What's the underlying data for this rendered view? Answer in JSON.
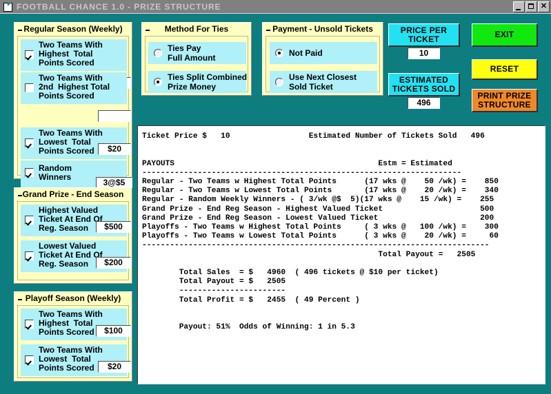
{
  "window": {
    "title": "FOOTBALL CHANCE  1.0 - PRIZE STRUCTURE",
    "minimize_label": "_",
    "maximize_label": "□",
    "close_label": "×",
    "colors": {
      "desktop": "#0d7d80",
      "titlebar": "#808080",
      "panel": "#ffffc0",
      "row": "#b0f0f8",
      "cyan_button": "#22e2f2",
      "green_button": "#10e810",
      "yellow_button": "#ffff10",
      "orange_button": "#f08828"
    }
  },
  "regular_season": {
    "title": "Regular Season (Weekly)",
    "rows": [
      {
        "label": "Two Teams With\nHighest  Total\nPoints Scored",
        "checked": true,
        "value": "$50"
      },
      {
        "label": "Two Teams With\n2nd  Highest Total\nPoints Scored",
        "checked": false,
        "value": ""
      },
      {
        "label": "Two Teams With\nLowest  Total\nPoints Scored",
        "checked": true,
        "value": "$20"
      },
      {
        "label": "Random\nWinners",
        "checked": true,
        "value": "3@$5"
      }
    ]
  },
  "grand_prize": {
    "title": "Grand Prize - End Season",
    "rows": [
      {
        "label": "Highest Valued\nTicket At End Of\nReg. Season",
        "checked": true,
        "value": "$500"
      },
      {
        "label": "Lowest Valued\nTicket At End Of\nReg. Season",
        "checked": true,
        "value": "$200"
      }
    ]
  },
  "playoff_season": {
    "title": "Playoff Season  (Weekly)",
    "rows": [
      {
        "label": "Two Teams With\nHighest  Total\nPoints Scored",
        "checked": true,
        "value": "$100"
      },
      {
        "label": "Two Teams With\nLowest  Total\nPoints Scored",
        "checked": true,
        "value": "$20"
      }
    ]
  },
  "method_for_ties": {
    "title": "Method For Ties",
    "options": [
      {
        "label": "Ties Pay\nFull Amount",
        "selected": false
      },
      {
        "label": "Ties Split Combined\nPrize Money",
        "selected": true
      }
    ]
  },
  "payment_unsold": {
    "title": "Payment - Unsold Tickets",
    "options": [
      {
        "label": "Not Paid",
        "selected": true
      },
      {
        "label": "Use Next Closest\nSold Ticket",
        "selected": false
      }
    ]
  },
  "controls": {
    "price_per_ticket_label": "PRICE PER\nTICKET",
    "price_per_ticket_value": "10",
    "estimated_tickets_label": "ESTIMATED\nTICKETS SOLD",
    "estimated_tickets_value": "496",
    "exit_label": "EXIT",
    "reset_label": "RESET",
    "print_label": "PRINT PRIZE\nSTRUCTURE"
  },
  "report": {
    "text": "Ticket Price $   10                 Estimated Number of Tickets Sold   496\n\n\nPAYOUTS                                            Estm = Estimated\n---------------------------------------------------------------------\nRegular - Two Teams w Highest Total Points      (17 wks @    50 /wk) =    850\nRegular - Two Teams w Lowest Total Points       (17 wks @    20 /wk) =    340\nRegular - Random Weekly Winners - ( 3/wk @$  5)(17 wks @    15 /wk) =    255\nGrand Prize - End Reg Season - Highest Valued Ticket                     500\nGrand Prize - End Reg Season - Lowest Valued Ticket                      200\nPlayoffs - Two Teams w Highest Total Points     ( 3 wks @   100 /wk) =    300\nPlayoffs - Two Teams w Lowest Total Points      ( 3 wks @    20 /wk) =     60\n---------------------------------------------------------------------------\n                                                   Total Payout =   2505\n\n        Total Sales  = $   4960  ( 496 tickets @ $10 per ticket)\n        Total Payout = $   2505\n        -----------------------\n        Total Profit = $   2455  ( 49 Percent )\n\n\n        Payout: 51%  Odds of Winning: 1 in 5.3"
  }
}
